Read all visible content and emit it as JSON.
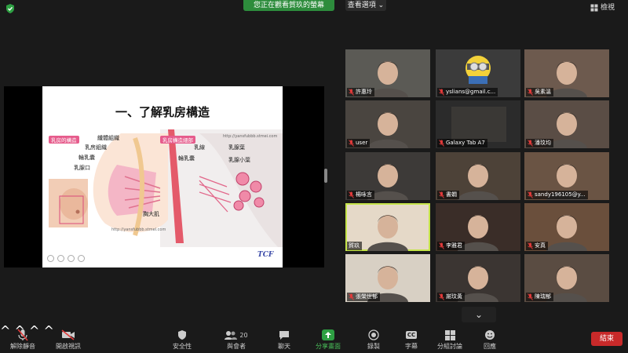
{
  "top": {
    "sharing_banner": "您正在觀看賀玖的螢幕",
    "view_options": "查看選項",
    "view_button": "檢視"
  },
  "slide": {
    "title": "一、了解乳房構造",
    "left_tag": "乳房的構造",
    "right_tag": "乳房構造細部",
    "left_labels": [
      "纖體組織",
      "乳房組織",
      "輪乳囊",
      "乳腺口"
    ],
    "muscle_label": "胸大肌",
    "right_labels": [
      "乳線",
      "乳腺葉",
      "輪乳囊",
      "乳腺小葉"
    ],
    "url_top": "http://yansfubbb.stmei.com",
    "url_bottom": "http://yansfubbb.stmel.com",
    "logo": "TCF"
  },
  "participants": [
    {
      "name": "許惠玲",
      "muted": true
    },
    {
      "name": "yslians@gmail.c...",
      "muted": true
    },
    {
      "name": "吳素溫",
      "muted": true
    },
    {
      "name": "user",
      "muted": true
    },
    {
      "name": "Galaxy Tab A7",
      "muted": true
    },
    {
      "name": "潘玟均",
      "muted": true
    },
    {
      "name": "楊咏言",
      "muted": true
    },
    {
      "name": "書嫺",
      "muted": true
    },
    {
      "name": "sandy196105@y...",
      "muted": true
    },
    {
      "name": "賀玖",
      "muted": false
    },
    {
      "name": "李雅君",
      "muted": true
    },
    {
      "name": "安真",
      "muted": true
    },
    {
      "name": "張榮世郁",
      "muted": true
    },
    {
      "name": "謝玟黃",
      "muted": true
    },
    {
      "name": "陳瑞郁",
      "muted": true
    }
  ],
  "toolbar": {
    "unmute": "解除靜音",
    "start_video": "開啟視訊",
    "security": "安全性",
    "participants": "與會者",
    "participant_count": "20",
    "chat": "聊天",
    "share_screen": "分享畫面",
    "record": "錄製",
    "cc": "字幕",
    "cc_badge": "CC",
    "breakout": "分組討論",
    "reactions": "回應",
    "end": "結束"
  },
  "colors": {
    "share_green": "#2d8c3c",
    "end_red": "#c82a2a",
    "active_speaker": "#c5e44a",
    "mute_red": "#e03a3a",
    "slide_pink": "#e65c8c"
  }
}
